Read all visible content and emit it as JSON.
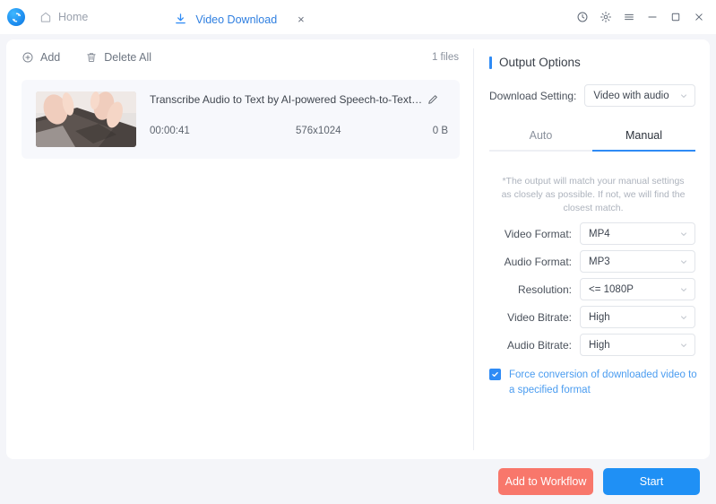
{
  "window": {
    "logo_name": "app-logo",
    "home_label": "Home",
    "controls": {
      "history_label": "History",
      "settings_label": "Settings",
      "menu_label": "Menu",
      "minimize_label": "Minimize",
      "maximize_label": "Maximize",
      "close_label": "Close"
    }
  },
  "tabs": [
    {
      "label": "Video Download",
      "icon": "download-icon",
      "close": "×",
      "active": true
    }
  ],
  "left_panel": {
    "toolbar": {
      "add_label": "Add",
      "delete_all_label": "Delete All",
      "file_count": "1 files"
    },
    "file": {
      "title": "Transcribe Audio to Text by AI-powered Speech-to-Text Conv...",
      "duration": "00:00:41",
      "resolution": "576x1024",
      "size": "0 B",
      "edit_icon": "pencil-icon",
      "thumbnail_alt": "hands typing on laptop"
    }
  },
  "right_panel": {
    "section_title": "Output Options",
    "download_setting": {
      "label": "Download Setting:",
      "value": "Video with audio"
    },
    "mode_tabs": [
      {
        "label": "Auto",
        "active": false
      },
      {
        "label": "Manual",
        "active": true
      }
    ],
    "note": "*The output will match your manual settings as closely as possible. If not, we will find the closest match.",
    "fields": [
      {
        "label": "Video Format:",
        "value": "MP4"
      },
      {
        "label": "Audio Format:",
        "value": "MP3"
      },
      {
        "label": "Resolution:",
        "value": "<= 1080P"
      },
      {
        "label": "Video Bitrate:",
        "value": "High"
      },
      {
        "label": "Audio Bitrate:",
        "value": "High"
      }
    ],
    "force_conversion": {
      "label": "Force conversion of downloaded video to a specified format",
      "checked": true
    }
  },
  "footer": {
    "add_to_workflow_label": "Add to Workflow",
    "start_label": "Start"
  },
  "colors": {
    "accent_blue": "#2f8bf5",
    "start_blue": "#1f90f5",
    "workflow_coral": "#f8776b",
    "page_bg": "#f4f5f9",
    "card_bg": "#f7f8fc"
  }
}
